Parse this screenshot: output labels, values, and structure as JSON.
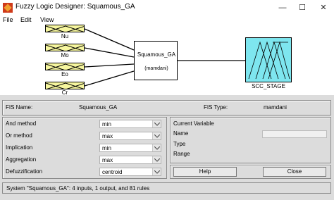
{
  "window": {
    "title": "Fuzzy Logic Designer: Squamous_GA",
    "minimize": "—",
    "maximize": "☐",
    "close": "✕"
  },
  "menu": {
    "items": [
      "File",
      "Edit",
      "View"
    ]
  },
  "diagram": {
    "inputs": [
      "Nu",
      "Mo",
      "Eo",
      "Cr"
    ],
    "input_color": "#f6f69e",
    "fis_name": "Squamous_GA",
    "fis_type": "(mamdani)",
    "output": "SCC_STAGE",
    "output_color": "#7ee6ef"
  },
  "fis_info": {
    "name_label": "FIS Name:",
    "name_value": "Squamous_GA",
    "type_label": "FIS Type:",
    "type_value": "mamdani"
  },
  "methods": [
    {
      "label": "And method",
      "value": "min"
    },
    {
      "label": "Or method",
      "value": "max"
    },
    {
      "label": "Implication",
      "value": "min"
    },
    {
      "label": "Aggregation",
      "value": "max"
    },
    {
      "label": "Defuzzification",
      "value": "centroid"
    }
  ],
  "current_variable": {
    "title": "Current Variable",
    "name_label": "Name",
    "type_label": "Type",
    "range_label": "Range"
  },
  "buttons": {
    "help": "Help",
    "close": "Close"
  },
  "status": "System \"Squamous_GA\": 4 inputs, 1 output, and 81 rules"
}
